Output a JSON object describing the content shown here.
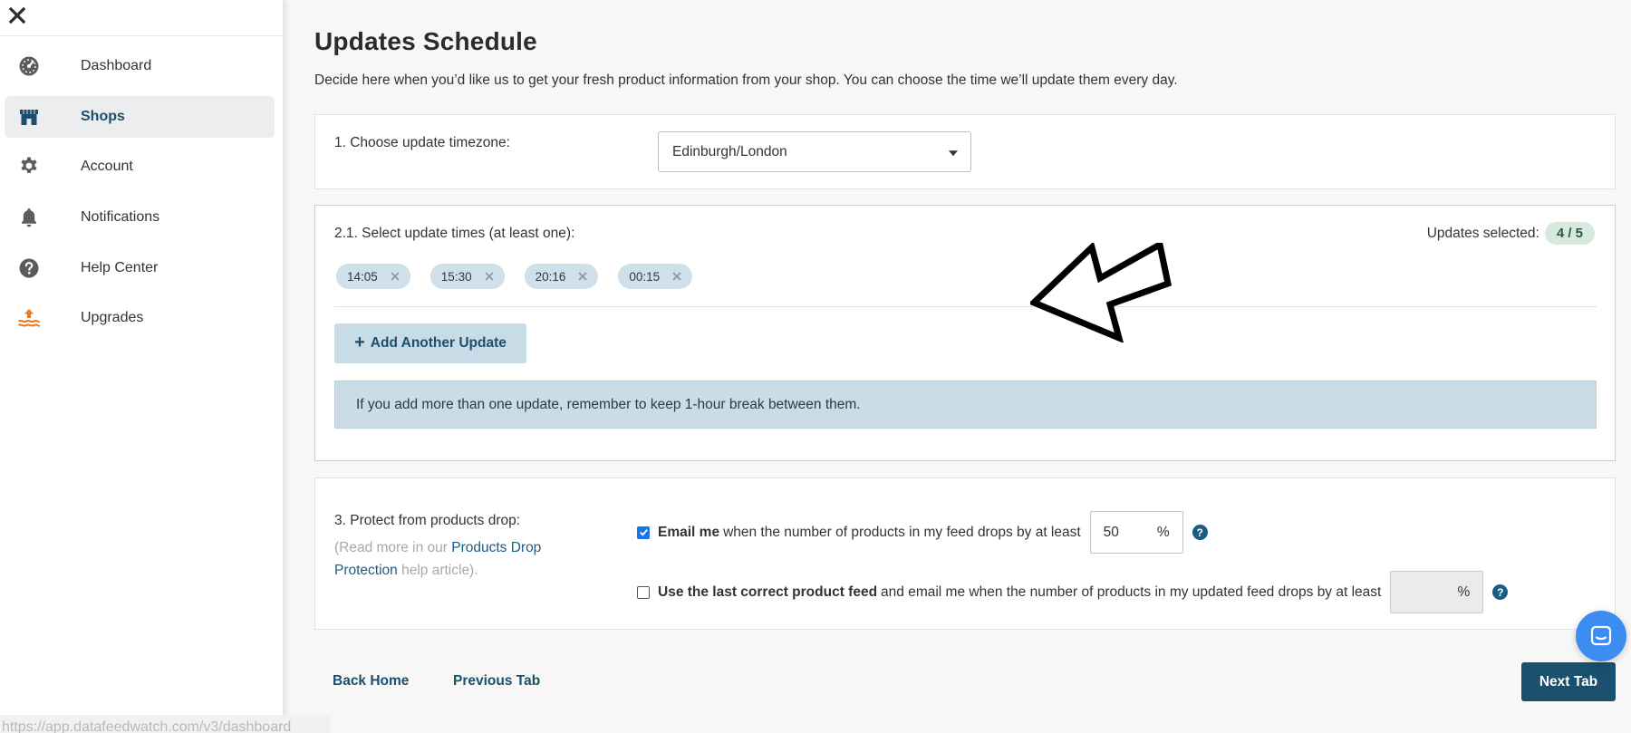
{
  "sidebar": {
    "items": [
      {
        "label": "Dashboard",
        "icon": "dashboard-gauge-icon"
      },
      {
        "label": "Shops",
        "icon": "shop-icon",
        "active": true
      },
      {
        "label": "Account",
        "icon": "gear-icon"
      },
      {
        "label": "Notifications",
        "icon": "bell-icon"
      },
      {
        "label": "Help Center",
        "icon": "question-circle-icon"
      },
      {
        "label": "Upgrades",
        "icon": "upgrade-arrow-icon"
      }
    ],
    "status_url": "https://app.datafeedwatch.com/v3/dashboard"
  },
  "page": {
    "title": "Updates Schedule",
    "description": "Decide here when you’d like us to get your fresh product information from your shop. You can choose the time we’ll update them every day."
  },
  "timezone": {
    "label": "1. Choose update timezone:",
    "selected": "Edinburgh/London"
  },
  "update_times": {
    "label": "2.1. Select update times (at least one):",
    "selected_label": "Updates selected:",
    "selected_count": "4 / 5",
    "times": [
      "14:05",
      "15:30",
      "20:16",
      "00:15"
    ],
    "add_button": "Add Another Update",
    "info": "If you add more than one update, remember to keep 1-hour break between them."
  },
  "protect": {
    "label": "3. Protect from products drop:",
    "help_prefix": "(Read more in our ",
    "help_link": "Products Drop Protection",
    "help_suffix": " help article).",
    "option1": {
      "bold": "Email me",
      "text": "when the number of products in my feed drops by at least",
      "value": "50",
      "unit": "%",
      "checked": true
    },
    "option2": {
      "bold": "Use the last correct product feed",
      "text": "and email me when the number of products in my updated feed drops by at least",
      "value": "",
      "unit": "%",
      "checked": false
    },
    "help_symbol": "?"
  },
  "footer": {
    "back_home": "Back Home",
    "previous_tab": "Previous Tab",
    "next_tab": "Next Tab"
  },
  "colors": {
    "brand": "#1b4f6e",
    "chip_bg": "#cfe0ea",
    "badge_bg": "#d6e9de",
    "info_bg": "#cadde7",
    "chat": "#3b8df1"
  }
}
